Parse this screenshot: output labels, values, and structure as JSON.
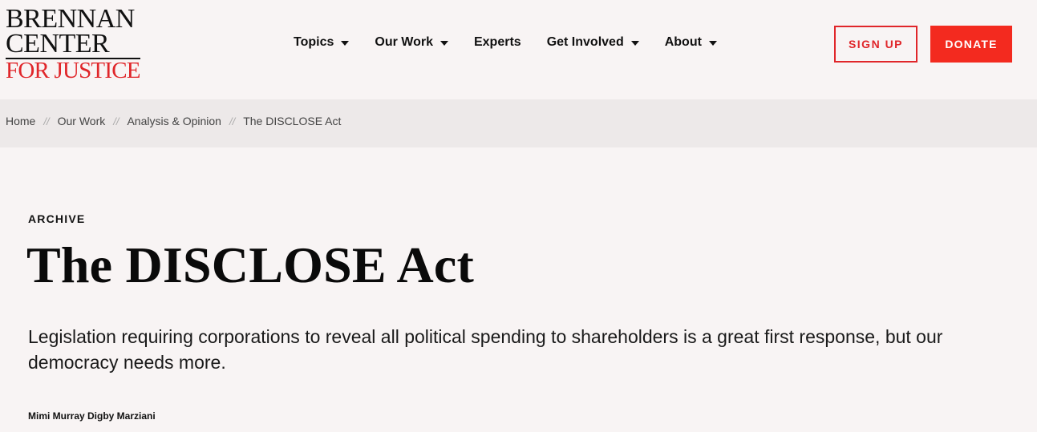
{
  "logo": {
    "line1": "BRENNAN",
    "line2": "CENTER",
    "line3": "FOR JUSTICE"
  },
  "nav": {
    "items": [
      {
        "label": "Topics",
        "dropdown": true
      },
      {
        "label": "Our Work",
        "dropdown": true
      },
      {
        "label": "Experts",
        "dropdown": false
      },
      {
        "label": "Get Involved",
        "dropdown": true
      },
      {
        "label": "About",
        "dropdown": true
      }
    ]
  },
  "actions": {
    "signup_label": "SIGN UP",
    "donate_label": "DONATE"
  },
  "breadcrumb": {
    "items": [
      "Home",
      "Our Work",
      "Analysis & Opinion",
      "The DISCLOSE Act"
    ],
    "separator": "//"
  },
  "article": {
    "eyebrow": "ARCHIVE",
    "title": "The DISCLOSE Act",
    "dek": "Legislation requiring corporations to reveal all political spending to shareholders is a great first response, but our democracy needs more.",
    "author": "Mimi Murray Digby Marziani"
  },
  "colors": {
    "accent": "#e0262a",
    "donate_bg": "#f32a1f",
    "page_bg": "#f8f4f4",
    "breadcrumb_bg": "#ede9e9"
  }
}
